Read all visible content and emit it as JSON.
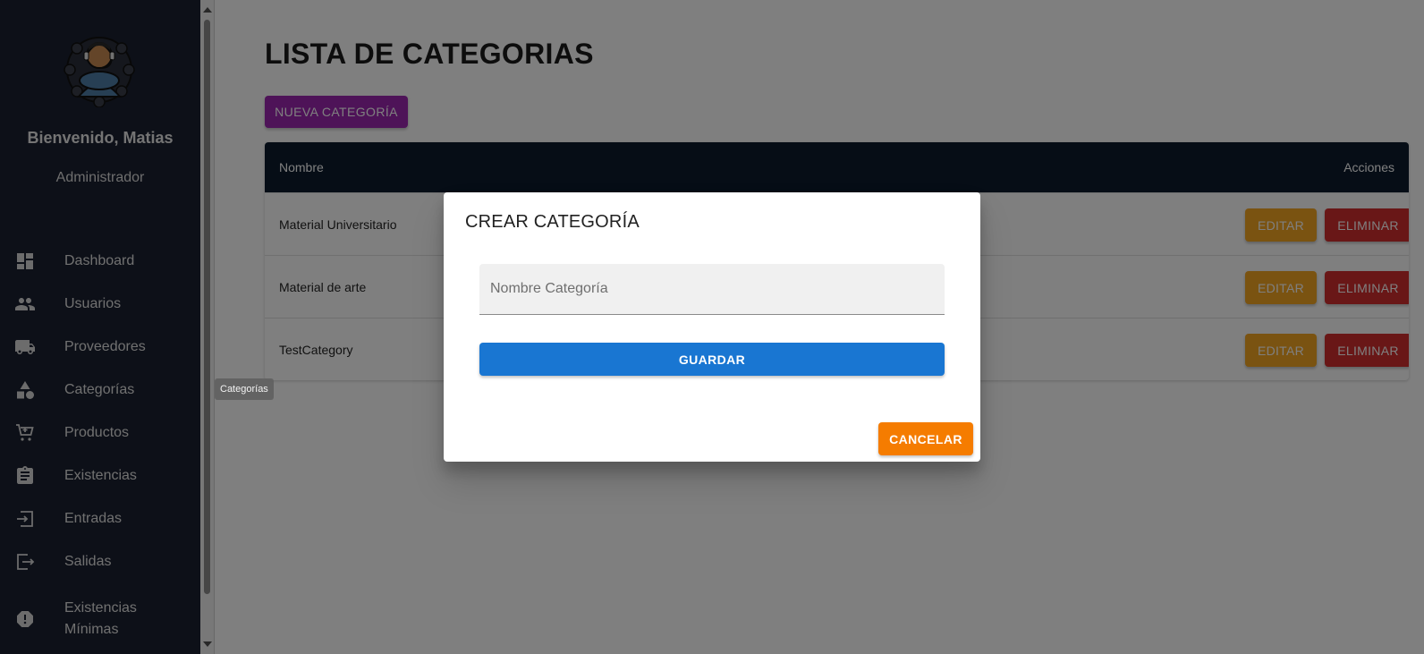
{
  "sidebar": {
    "welcome": "Bienvenido, Matias",
    "role": "Administrador",
    "items": [
      {
        "label": "Dashboard",
        "icon": "dashboard-icon"
      },
      {
        "label": "Usuarios",
        "icon": "users-icon"
      },
      {
        "label": "Proveedores",
        "icon": "truck-icon"
      },
      {
        "label": "Categorías",
        "icon": "category-icon"
      },
      {
        "label": "Productos",
        "icon": "cart-icon"
      },
      {
        "label": "Existencias",
        "icon": "clipboard-icon"
      },
      {
        "label": "Entradas",
        "icon": "login-icon"
      },
      {
        "label": "Salidas",
        "icon": "logout-icon"
      },
      {
        "label": "Existencias Mínimas",
        "icon": "alert-icon"
      }
    ],
    "tooltip": "Categorías"
  },
  "main": {
    "title": "LISTA DE CATEGORIAS",
    "new_button": "NUEVA CATEGORÍA",
    "table": {
      "col_name": "Nombre",
      "col_actions": "Acciones",
      "rows": [
        {
          "name": "Material Universitario"
        },
        {
          "name": "Material de arte"
        },
        {
          "name": "TestCategory"
        }
      ],
      "edit_label": "EDITAR",
      "delete_label": "ELIMINAR"
    }
  },
  "dialog": {
    "title": "CREAR CATEGORÍA",
    "field_placeholder": "Nombre Categoría",
    "field_value": "",
    "save_label": "GUARDAR",
    "cancel_label": "CANCELAR"
  },
  "colors": {
    "sidebar_bg": "#1b2130",
    "table_header": "#0c1a2c",
    "purple": "#9c27b0",
    "edit": "#f5a623",
    "delete": "#d32f2f",
    "save": "#1976d2",
    "cancel": "#f57c00"
  }
}
